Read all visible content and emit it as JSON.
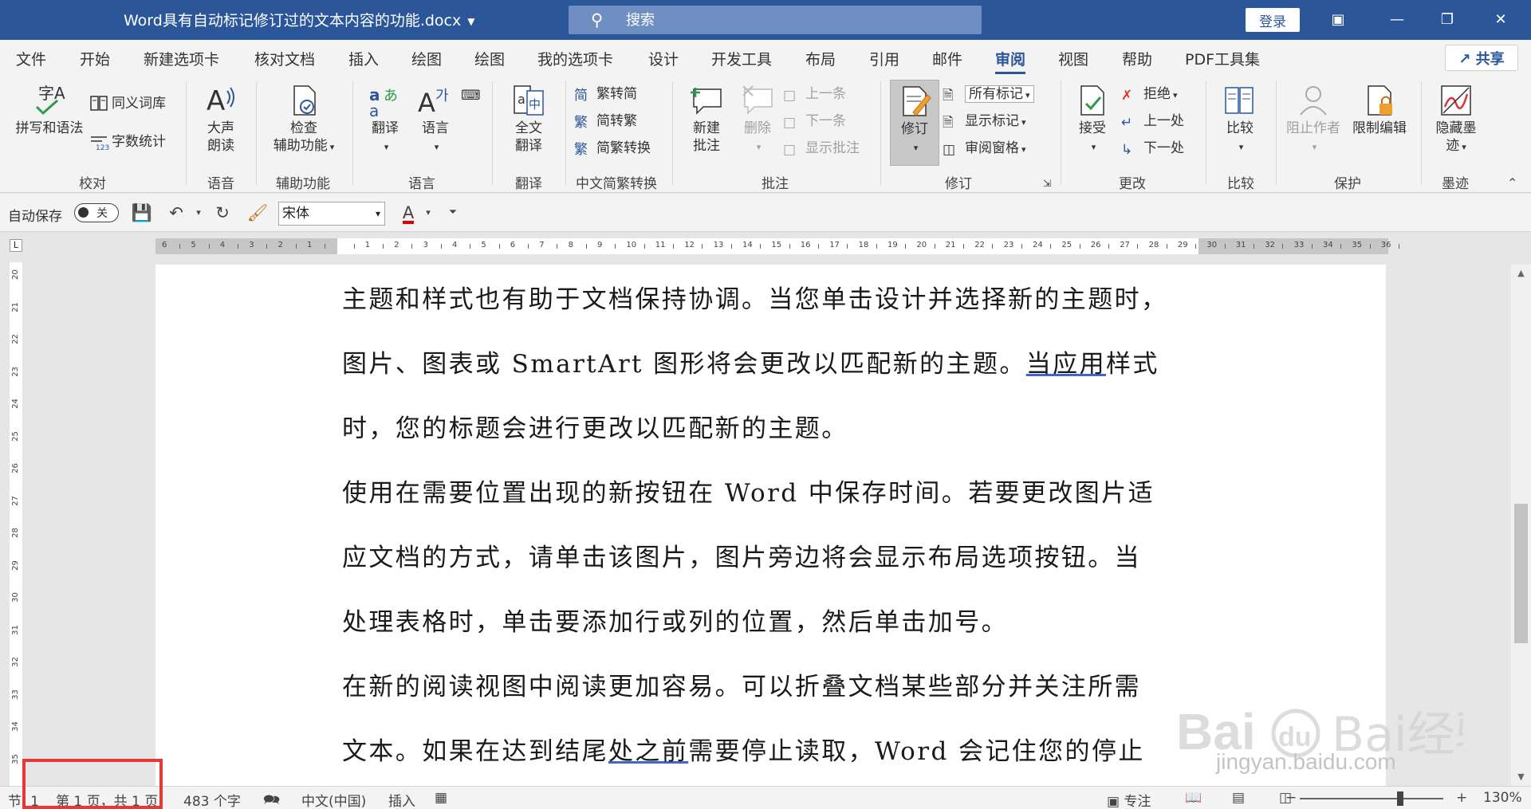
{
  "titlebar": {
    "doc_title": "Word具有自动标记修订过的文本内容的功能.docx",
    "search_placeholder": "搜索",
    "login": "登录"
  },
  "tabs": [
    "文件",
    "开始",
    "新建选项卡",
    "核对文档",
    "插入",
    "绘图",
    "绘图",
    "我的选项卡",
    "设计",
    "开发工具",
    "布局",
    "引用",
    "邮件",
    "审阅",
    "视图",
    "帮助",
    "PDF工具集"
  ],
  "active_tab": "审阅",
  "share": "共享",
  "ribbon": {
    "proofing": {
      "label": "校对",
      "spelling": "拼写和语法",
      "thesaurus": "同义词库",
      "wordcount": "字数统计"
    },
    "speech": {
      "label": "语音",
      "read_aloud_1": "大声",
      "read_aloud_2": "朗读"
    },
    "accessibility": {
      "label": "辅助功能",
      "check_1": "检查",
      "check_2": "辅助功能"
    },
    "language": {
      "label": "语言",
      "translate": "翻译",
      "language": "语言"
    },
    "translate": {
      "label": "翻译",
      "full_1": "全文",
      "full_2": "翻译"
    },
    "chinese": {
      "label": "中文简繁转换",
      "to_trad": "繁转简",
      "to_simp": "简转繁",
      "convert": "简繁转换"
    },
    "comments": {
      "label": "批注",
      "new_1": "新建",
      "new_2": "批注",
      "delete": "删除",
      "prev": "上一条",
      "next": "下一条",
      "show": "显示批注"
    },
    "tracking": {
      "label": "修订",
      "track": "修订",
      "all_markup": "所有标记",
      "show_markup": "显示标记",
      "pane": "审阅窗格"
    },
    "changes": {
      "label": "更改",
      "accept": "接受",
      "reject": "拒绝",
      "prev": "上一处",
      "next": "下一处"
    },
    "compare": {
      "label": "比较",
      "compare": "比较"
    },
    "protect": {
      "label": "保护",
      "block": "阻止作者",
      "restrict": "限制编辑"
    },
    "ink": {
      "label": "墨迹",
      "hide_1": "隐藏墨",
      "hide_2": "迹"
    }
  },
  "qat": {
    "autosave": "自动保存",
    "toggle": "关",
    "font": "宋体",
    "font_color_glyph": "A"
  },
  "ruler_numbers": [
    "6",
    "5",
    "4",
    "3",
    "2",
    "1",
    "",
    "1",
    "2",
    "3",
    "4",
    "5",
    "6",
    "7",
    "8",
    "9",
    "10",
    "11",
    "12",
    "13",
    "14",
    "15",
    "16",
    "17",
    "18",
    "19",
    "20",
    "21",
    "22",
    "23",
    "24",
    "25",
    "26",
    "27",
    "28",
    "29",
    "30",
    "31",
    "32",
    "33",
    "34",
    "35",
    "36"
  ],
  "vruler_numbers": [
    "20",
    "21",
    "22",
    "23",
    "24",
    "25",
    "26",
    "27",
    "28",
    "29",
    "30",
    "31",
    "32",
    "33",
    "34",
    "35"
  ],
  "document": {
    "lines": [
      [
        {
          "t": "主题和样式也有助于文档保持协调。当您单击设计并选择新的主题时，"
        }
      ],
      [
        {
          "t": "图片、图表或 SmartArt 图形将会更改以匹配新的主题。"
        },
        {
          "t": "当应用",
          "rev": true
        },
        {
          "t": "样式"
        }
      ],
      [
        {
          "t": "时，您的标题会进行更改以匹配新的主题。"
        }
      ],
      [
        {
          "t": "使用在需要位置出现的新按钮在 Word 中保存时间。若要更改图片适"
        }
      ],
      [
        {
          "t": "应文档的方式，请单击该图片，图片旁边将会显示布局选项按钮。当"
        }
      ],
      [
        {
          "t": "处理表格时，单击要添加行或列的位置，然后单击加号。"
        }
      ],
      [
        {
          "t": "在新的阅读视图中阅读更加容易。可以折叠文档某些部分并关注所需"
        }
      ],
      [
        {
          "t": "文本。如果在达到结尾"
        },
        {
          "t": "处之前",
          "rev": true
        },
        {
          "t": "需要停止读取，Word 会记住您的停止"
        }
      ]
    ]
  },
  "statusbar": {
    "section": "节: 1",
    "page": "第 1 页，共 1 页",
    "words": "483 个字",
    "language": "中文(中国)",
    "insert": "插入",
    "focus": "专注",
    "zoom": "130%",
    "zoom_minus": "−",
    "zoom_plus": "+"
  },
  "watermark": {
    "text": "jingyan.baidu.com",
    "brand": "Bai经验"
  },
  "colors": {
    "titlebar": "#2b579a",
    "accent": "#2b579a",
    "highlight_box": "#e53935",
    "revision_underline": "#4466cc"
  }
}
